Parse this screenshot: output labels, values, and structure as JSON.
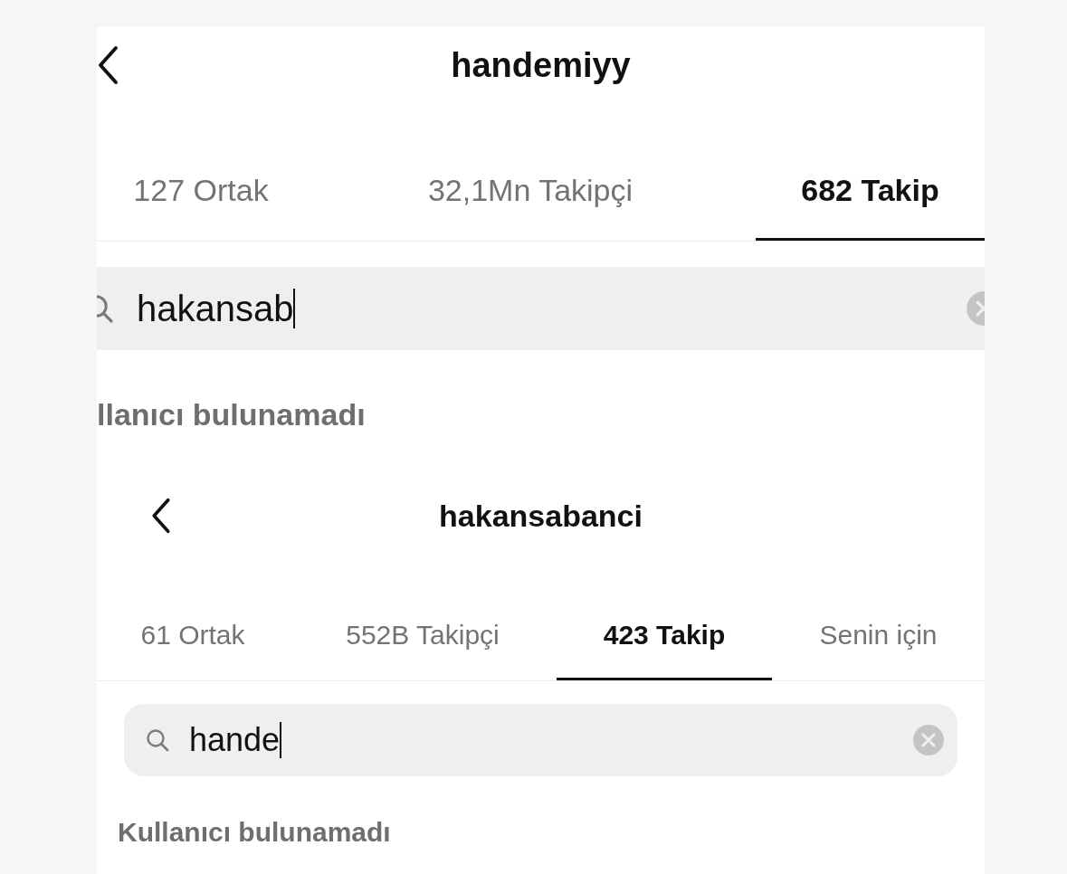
{
  "screens": [
    {
      "title": "handemiyy",
      "tabs": [
        {
          "label": "127 Ortak",
          "selected": false
        },
        {
          "label": "32,1Mn Takipçi",
          "selected": false
        },
        {
          "label": "682 Takip",
          "selected": true
        }
      ],
      "search": {
        "value": "hakansab",
        "focused": true
      },
      "message": "llanıcı bulunamadı"
    },
    {
      "title": "hakansabanci",
      "tabs": [
        {
          "label": "61 Ortak",
          "selected": false
        },
        {
          "label": "552B Takipçi",
          "selected": false
        },
        {
          "label": "423 Takip",
          "selected": true
        },
        {
          "label": "Senin için",
          "selected": false
        }
      ],
      "search": {
        "value": "hande",
        "focused": true
      },
      "message": "Kullanıcı bulunamadı"
    }
  ]
}
